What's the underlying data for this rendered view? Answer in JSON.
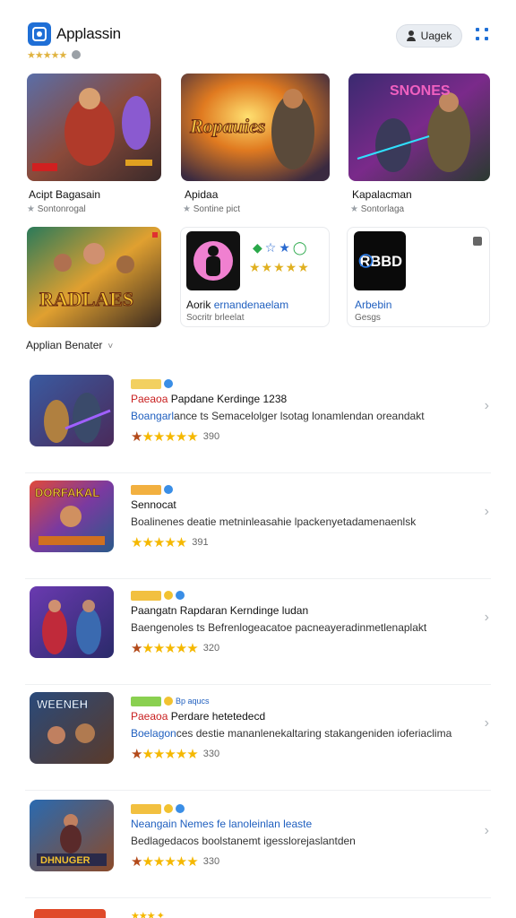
{
  "header": {
    "app_name": "Applassin",
    "rating_stars": "★★★★★",
    "login_label": "Uagek"
  },
  "featured": [
    {
      "title": "Acipt Bagasain",
      "subtitle": "Sontonrogal"
    },
    {
      "title": "Apidaa",
      "subtitle": "Sontine pict"
    },
    {
      "title": "Kapalacman",
      "subtitle": "Sontorlaga"
    }
  ],
  "featured_row2": [
    {
      "title": "",
      "subtitle": ""
    },
    {
      "title": "Aorik",
      "title_blue": "ernandenaelam",
      "subtitle": "Socritr brleelat"
    },
    {
      "title_blue": "Arbebin",
      "subtitle": "Gesgs"
    }
  ],
  "banner_texts": {
    "ropauies": "Ropauies",
    "snones": "SNONES",
    "radlaes": "RADLAES",
    "rbbd": "RBBD"
  },
  "section": {
    "title": "Applian Benater",
    "chevron": "˅"
  },
  "list": [
    {
      "title_red": "Paeaoa",
      "title": "Papdane Kerdinge 1238",
      "desc_blue": "Boangarl",
      "desc": "ance ts Semacelolger lsotag lonamlendan oreandakt",
      "count": "390",
      "thumb_text": ""
    },
    {
      "title_red": "",
      "title": "Sennocat",
      "desc_blue": "",
      "desc": "Boalinenes deatie metninleasahie lpackenyetadamenaenlsk",
      "count": "391",
      "thumb_text": "DORFAKAL"
    },
    {
      "title_red": "",
      "title": "Paangatn Rapdaran Kerndinge ludan",
      "desc_blue": "",
      "desc": "Baengenoles ts Befrenlogeacatoe pacneayeradinmetlenaplakt",
      "count": "320",
      "thumb_text": ""
    },
    {
      "title_red": "Paeaoa",
      "title": "Perdare hetetedecd",
      "desc_blue": "Boelagon",
      "desc": "ces destie mananlenekaltaring stakangeniden ioferiaclima",
      "count": "330",
      "thumb_text": "WEENEH"
    },
    {
      "title_red": "",
      "title": "Neangain Nemes fe lanoleinlan leaste",
      "desc_blue": "",
      "desc": "Bedlagedacos boolstanemt igesslorejaslantden",
      "count": "330",
      "thumb_text": "DHNUGER"
    }
  ]
}
